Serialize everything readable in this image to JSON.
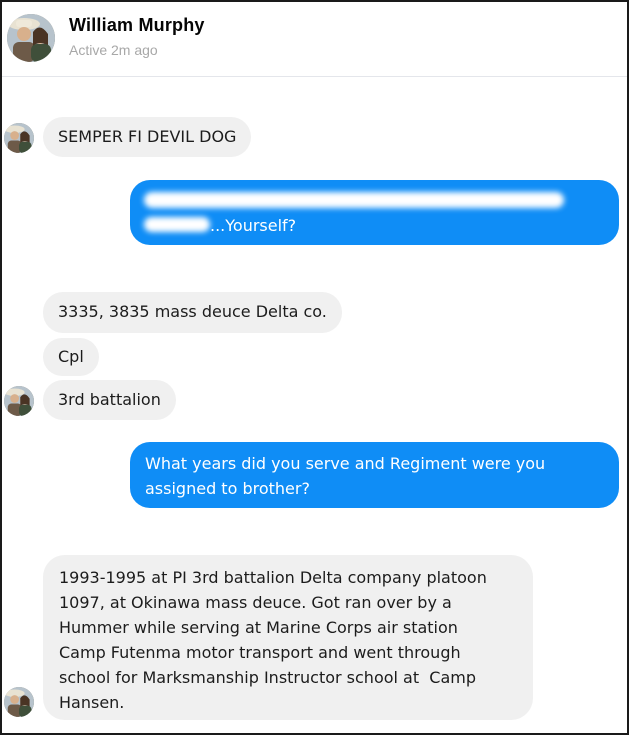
{
  "contact": {
    "name": "William Murphy",
    "status": "Active 2m ago"
  },
  "messages": [
    {
      "from": "contact",
      "text": "SEMPER FI DEVIL DOG"
    },
    {
      "from": "me",
      "text": "...Yourself?",
      "redacted": true
    },
    {
      "from": "contact",
      "text": "3335, 3835 mass deuce Delta co."
    },
    {
      "from": "contact",
      "text": "Cpl"
    },
    {
      "from": "contact",
      "text": "3rd battalion"
    },
    {
      "from": "me",
      "lines": [
        "What years did you serve and Regiment were you",
        "assigned to brother?"
      ]
    },
    {
      "from": "contact",
      "lines": [
        "1993-1995 at PI 3rd battalion Delta company platoon",
        "1097, at Okinawa mass deuce. Got ran over by a",
        "Hummer while serving at Marine Corps air station",
        "Camp Futenma motor transport and went through",
        "school for Marksmanship Instructor school at  Camp",
        "Hansen."
      ]
    }
  ],
  "colors": {
    "outgoing_bubble": "#0f8df6",
    "incoming_bubble": "#f0f0f0",
    "status_text": "#a8a8a8"
  }
}
